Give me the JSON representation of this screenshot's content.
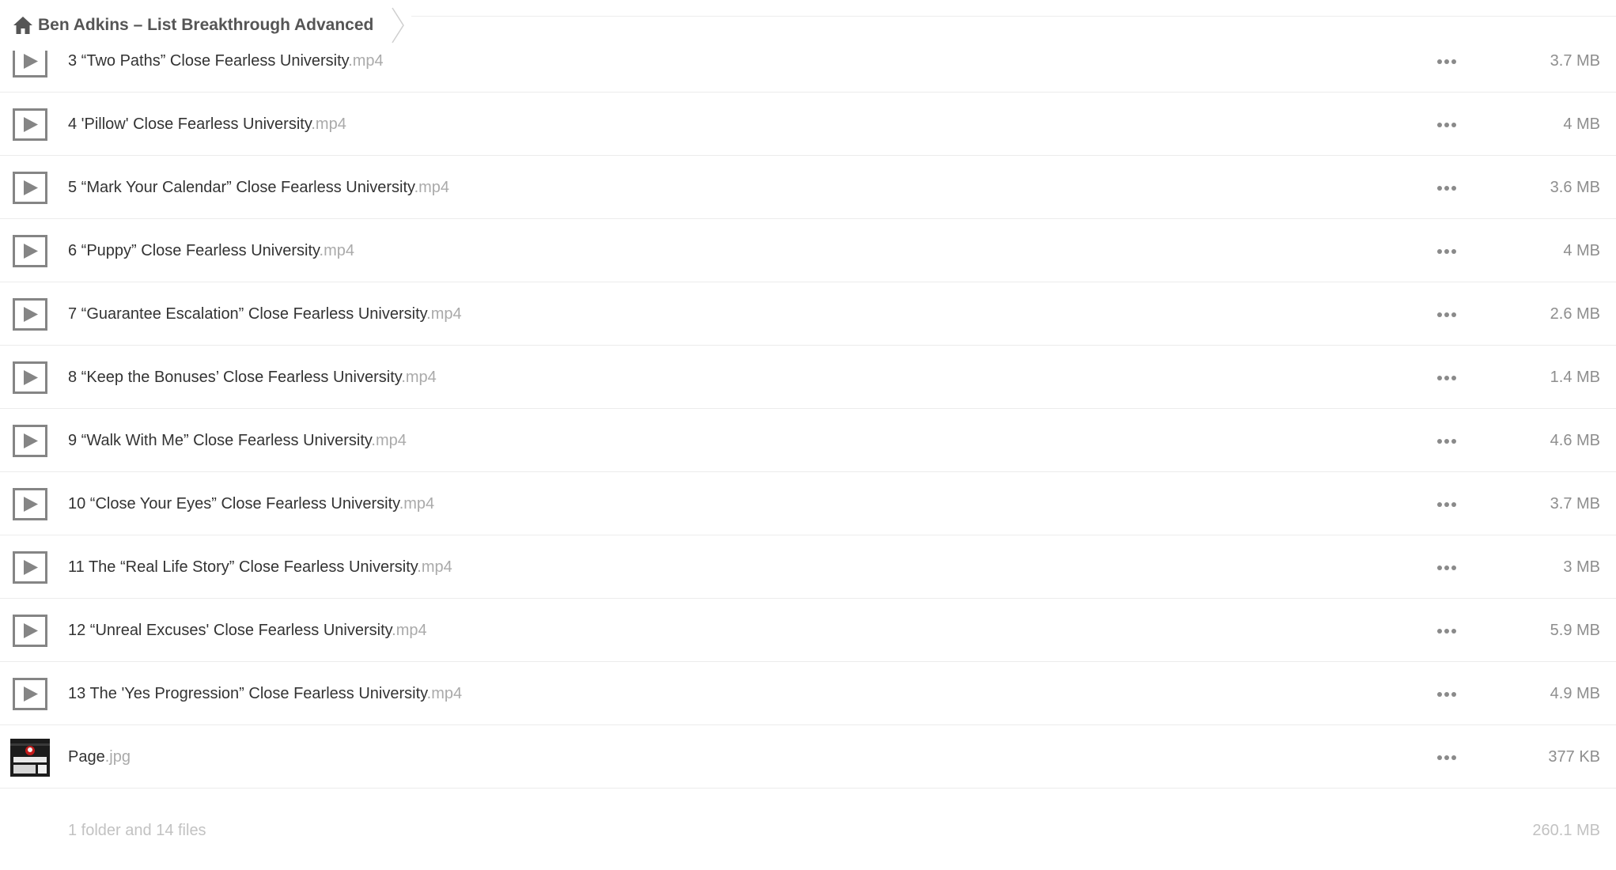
{
  "breadcrumb": {
    "home_icon": "home-icon",
    "title": "Ben Adkins – List Breakthrough Advanced",
    "separator_icon": "chevron-right-icon"
  },
  "files": [
    {
      "icon": "play-icon",
      "basename": "3 “Two Paths” Close Fearless University",
      "ext": ".mp4",
      "size": "3.7 MB"
    },
    {
      "icon": "play-icon",
      "basename": "4 'Pillow' Close Fearless University",
      "ext": ".mp4",
      "size": "4 MB"
    },
    {
      "icon": "play-icon",
      "basename": "5 “Mark Your Calendar” Close Fearless University",
      "ext": ".mp4",
      "size": "3.6 MB"
    },
    {
      "icon": "play-icon",
      "basename": "6 “Puppy” Close Fearless University",
      "ext": ".mp4",
      "size": "4 MB"
    },
    {
      "icon": "play-icon",
      "basename": "7 “Guarantee Escalation” Close Fearless University",
      "ext": ".mp4",
      "size": "2.6 MB"
    },
    {
      "icon": "play-icon",
      "basename": "8 “Keep the Bonuses’ Close Fearless University",
      "ext": ".mp4",
      "size": "1.4 MB"
    },
    {
      "icon": "play-icon",
      "basename": "9 “Walk With Me” Close Fearless University",
      "ext": ".mp4",
      "size": "4.6 MB"
    },
    {
      "icon": "play-icon",
      "basename": "10 “Close Your Eyes” Close Fearless University",
      "ext": ".mp4",
      "size": "3.7 MB"
    },
    {
      "icon": "play-icon",
      "basename": "11 The “Real Life Story” Close Fearless University",
      "ext": ".mp4",
      "size": "3 MB"
    },
    {
      "icon": "play-icon",
      "basename": "12 “Unreal Excuses' Close Fearless University",
      "ext": ".mp4",
      "size": "5.9 MB"
    },
    {
      "icon": "play-icon",
      "basename": "13 The 'Yes Progression” Close Fearless University",
      "ext": ".mp4",
      "size": "4.9 MB"
    },
    {
      "icon": "image-thumbnail",
      "basename": "Page",
      "ext": ".jpg",
      "size": "377 KB"
    }
  ],
  "more_icon": "more-options-icon",
  "summary": {
    "count": "1 folder and 14 files",
    "total": "260.1 MB"
  },
  "colors": {
    "text": "#333333",
    "extension": "#aaaaaa",
    "size": "#8e8e8e",
    "summary": "#c2c2c2",
    "icon": "#858585",
    "divider": "#ececec"
  }
}
